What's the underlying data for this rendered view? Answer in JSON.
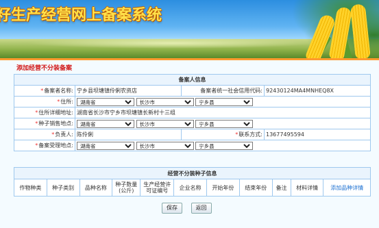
{
  "header": {
    "title": "籽生产经营网上备案系统"
  },
  "page": {
    "title": "添加经营不分装备案"
  },
  "filer": {
    "section_title": "备案人信息",
    "name_label": "备案者名称:",
    "name_value": "宁乡县坝塘镇伶俐农资店",
    "credit_label": "备案者统一社会信用代码:",
    "credit_value": "92430124MA4MNHEQ8X",
    "residence_label": "住所:",
    "residence_province": "湖南省",
    "residence_city": "长沙市",
    "residence_county": "宁乡县",
    "address_label": "住所详细地址:",
    "address_value": "湖南省长沙市宁乡市坝塘镇长新村十三组",
    "sale_label": "种子销售地点:",
    "sale_province": "湖南省",
    "sale_city": "长沙市",
    "sale_county": "宁乡县",
    "person_label": "负责人:",
    "person_value": "陈伶俐",
    "contact_label": "联系方式:",
    "contact_value": "13677495594",
    "accept_label": "备案受理地点:",
    "accept_province": "湖南省",
    "accept_city": "长沙市",
    "accept_county": "宁乡县"
  },
  "seeds": {
    "section_title": "经营不分装种子信息",
    "columns": [
      "作物种类",
      "种子类别",
      "品种名称",
      "种子数量(公斤)",
      "生产经营许可证编号",
      "企业名称",
      "开始年份",
      "结束年份",
      "备注",
      "材料详情"
    ],
    "add_link": "添加品种详情"
  },
  "actions": {
    "save": "保存",
    "back": "返回"
  }
}
